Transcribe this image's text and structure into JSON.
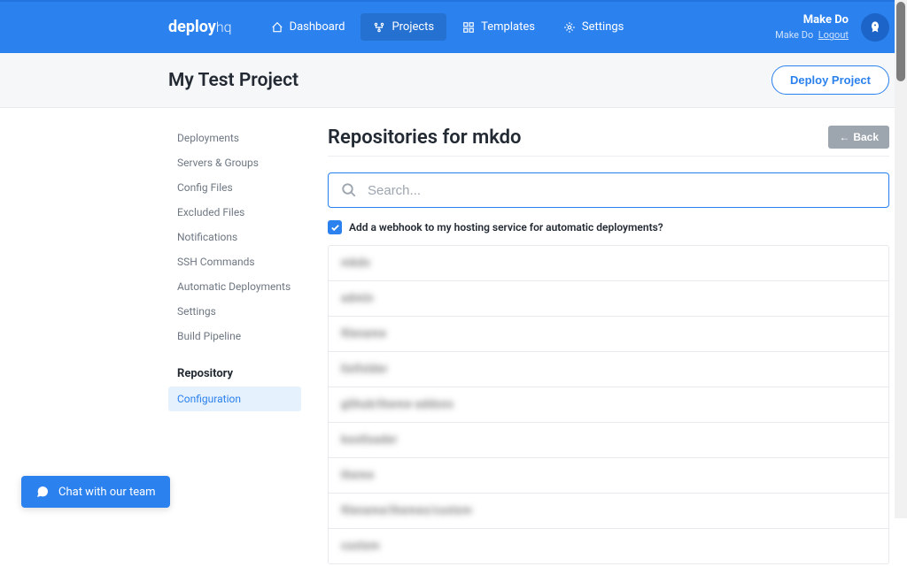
{
  "brand": {
    "prefix": "deploy",
    "suffix": "hq"
  },
  "nav": {
    "dashboard": "Dashboard",
    "projects": "Projects",
    "templates": "Templates",
    "settings": "Settings"
  },
  "user": {
    "name": "Make Do",
    "org": "Make Do",
    "logout": "Logout"
  },
  "project": {
    "title": "My Test Project",
    "deploy_label": "Deploy Project"
  },
  "sidebar": {
    "items": [
      "Deployments",
      "Servers & Groups",
      "Config Files",
      "Excluded Files",
      "Notifications",
      "SSH Commands",
      "Automatic Deployments",
      "Settings",
      "Build Pipeline"
    ],
    "heading": "Repository",
    "configuration": "Configuration"
  },
  "content": {
    "title": "Repositories for mkdo",
    "back": "Back",
    "search_placeholder": "Search...",
    "webhook_label": "Add a webhook to my hosting service for automatic deployments?"
  },
  "repos": [
    "mkdo",
    "admin",
    "filename",
    "listfolder",
    "github/theme-addons",
    "bootloader",
    "theme",
    "filename/themes/custom",
    "custom"
  ],
  "chat": {
    "label": "Chat with our team"
  }
}
